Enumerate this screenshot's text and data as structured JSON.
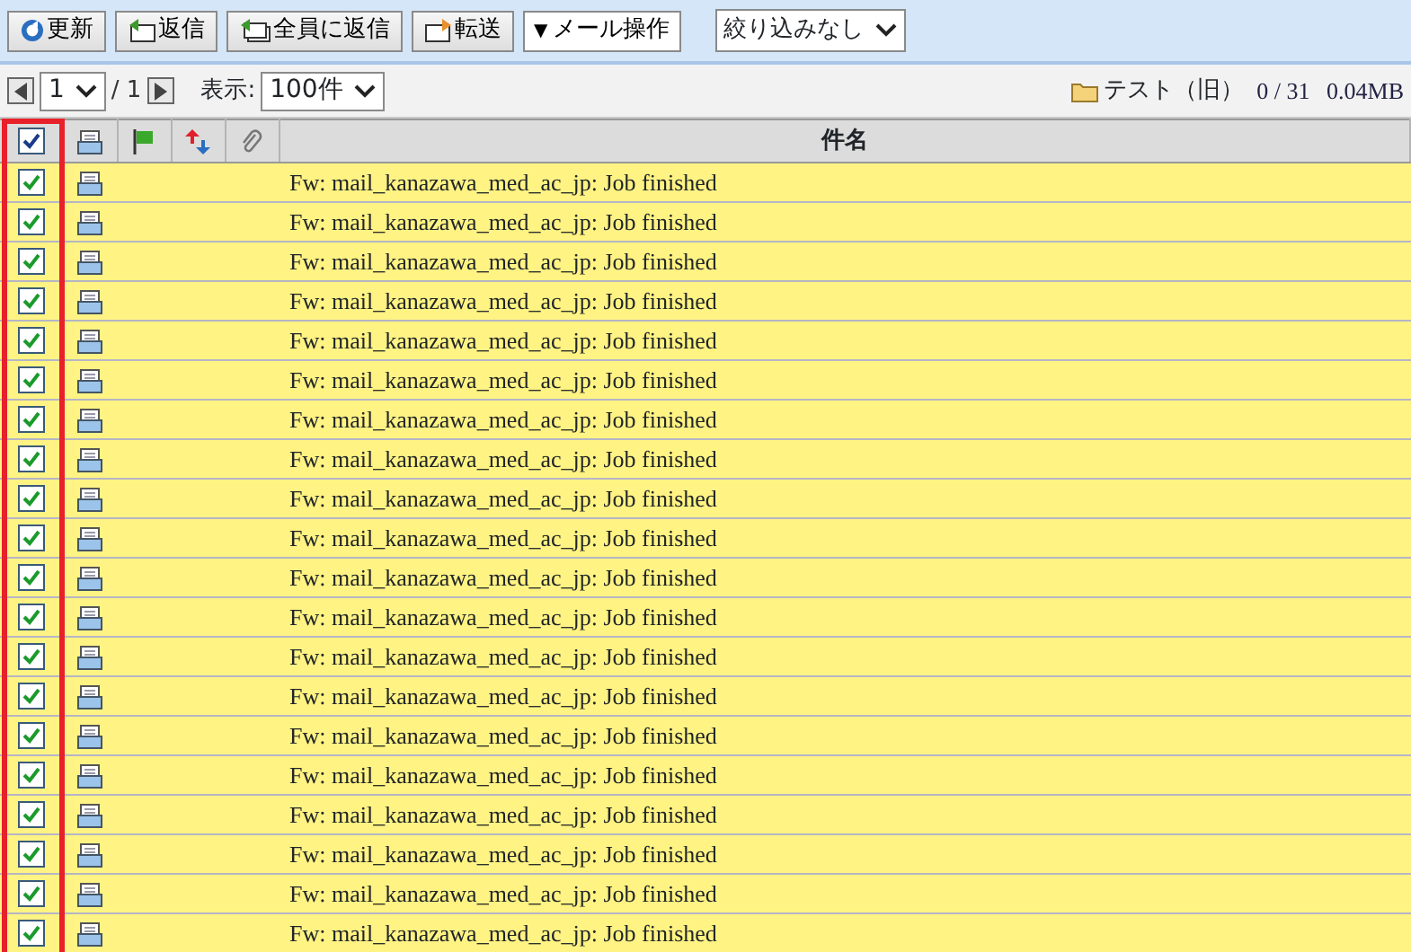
{
  "toolbar": {
    "buttons": [
      {
        "kind": "refresh",
        "label": "更新"
      },
      {
        "kind": "reply",
        "label": "返信"
      },
      {
        "kind": "reply-all",
        "label": "全員に返信"
      },
      {
        "kind": "forward",
        "label": "転送"
      }
    ],
    "menu": {
      "caret": "▼",
      "label": "メール操作"
    },
    "filter": {
      "value": "絞り込みなし"
    }
  },
  "pager": {
    "page": "1",
    "total": "/ 1",
    "display_label": "表示:",
    "per_page": "100件"
  },
  "folder": {
    "name": "テスト（旧）",
    "count": "0 / 31",
    "size": "0.04MB"
  },
  "table": {
    "select_all_checked": true,
    "select_column_highlighted": true,
    "columns": [
      {
        "kind": "check"
      },
      {
        "kind": "read"
      },
      {
        "kind": "flag"
      },
      {
        "kind": "priority"
      },
      {
        "kind": "attachment"
      },
      {
        "kind": "text",
        "label": "件名"
      }
    ],
    "rows": [
      {
        "checked": true,
        "subject": "Fw: mail_kanazawa_med_ac_jp: Job finished"
      },
      {
        "checked": true,
        "subject": "Fw: mail_kanazawa_med_ac_jp: Job finished"
      },
      {
        "checked": true,
        "subject": "Fw: mail_kanazawa_med_ac_jp: Job finished"
      },
      {
        "checked": true,
        "subject": "Fw: mail_kanazawa_med_ac_jp: Job finished"
      },
      {
        "checked": true,
        "subject": "Fw: mail_kanazawa_med_ac_jp: Job finished"
      },
      {
        "checked": true,
        "subject": "Fw: mail_kanazawa_med_ac_jp: Job finished"
      },
      {
        "checked": true,
        "subject": "Fw: mail_kanazawa_med_ac_jp: Job finished"
      },
      {
        "checked": true,
        "subject": "Fw: mail_kanazawa_med_ac_jp: Job finished"
      },
      {
        "checked": true,
        "subject": "Fw: mail_kanazawa_med_ac_jp: Job finished"
      },
      {
        "checked": true,
        "subject": "Fw: mail_kanazawa_med_ac_jp: Job finished"
      },
      {
        "checked": true,
        "subject": "Fw: mail_kanazawa_med_ac_jp: Job finished"
      },
      {
        "checked": true,
        "subject": "Fw: mail_kanazawa_med_ac_jp: Job finished"
      },
      {
        "checked": true,
        "subject": "Fw: mail_kanazawa_med_ac_jp: Job finished"
      },
      {
        "checked": true,
        "subject": "Fw: mail_kanazawa_med_ac_jp: Job finished"
      },
      {
        "checked": true,
        "subject": "Fw: mail_kanazawa_med_ac_jp: Job finished"
      },
      {
        "checked": true,
        "subject": "Fw: mail_kanazawa_med_ac_jp: Job finished"
      },
      {
        "checked": true,
        "subject": "Fw: mail_kanazawa_med_ac_jp: Job finished"
      },
      {
        "checked": true,
        "subject": "Fw: mail_kanazawa_med_ac_jp: Job finished"
      },
      {
        "checked": true,
        "subject": "Fw: mail_kanazawa_med_ac_jp: Job finished"
      },
      {
        "checked": true,
        "subject": "Fw: mail_kanazawa_med_ac_jp: Job finished"
      }
    ]
  }
}
